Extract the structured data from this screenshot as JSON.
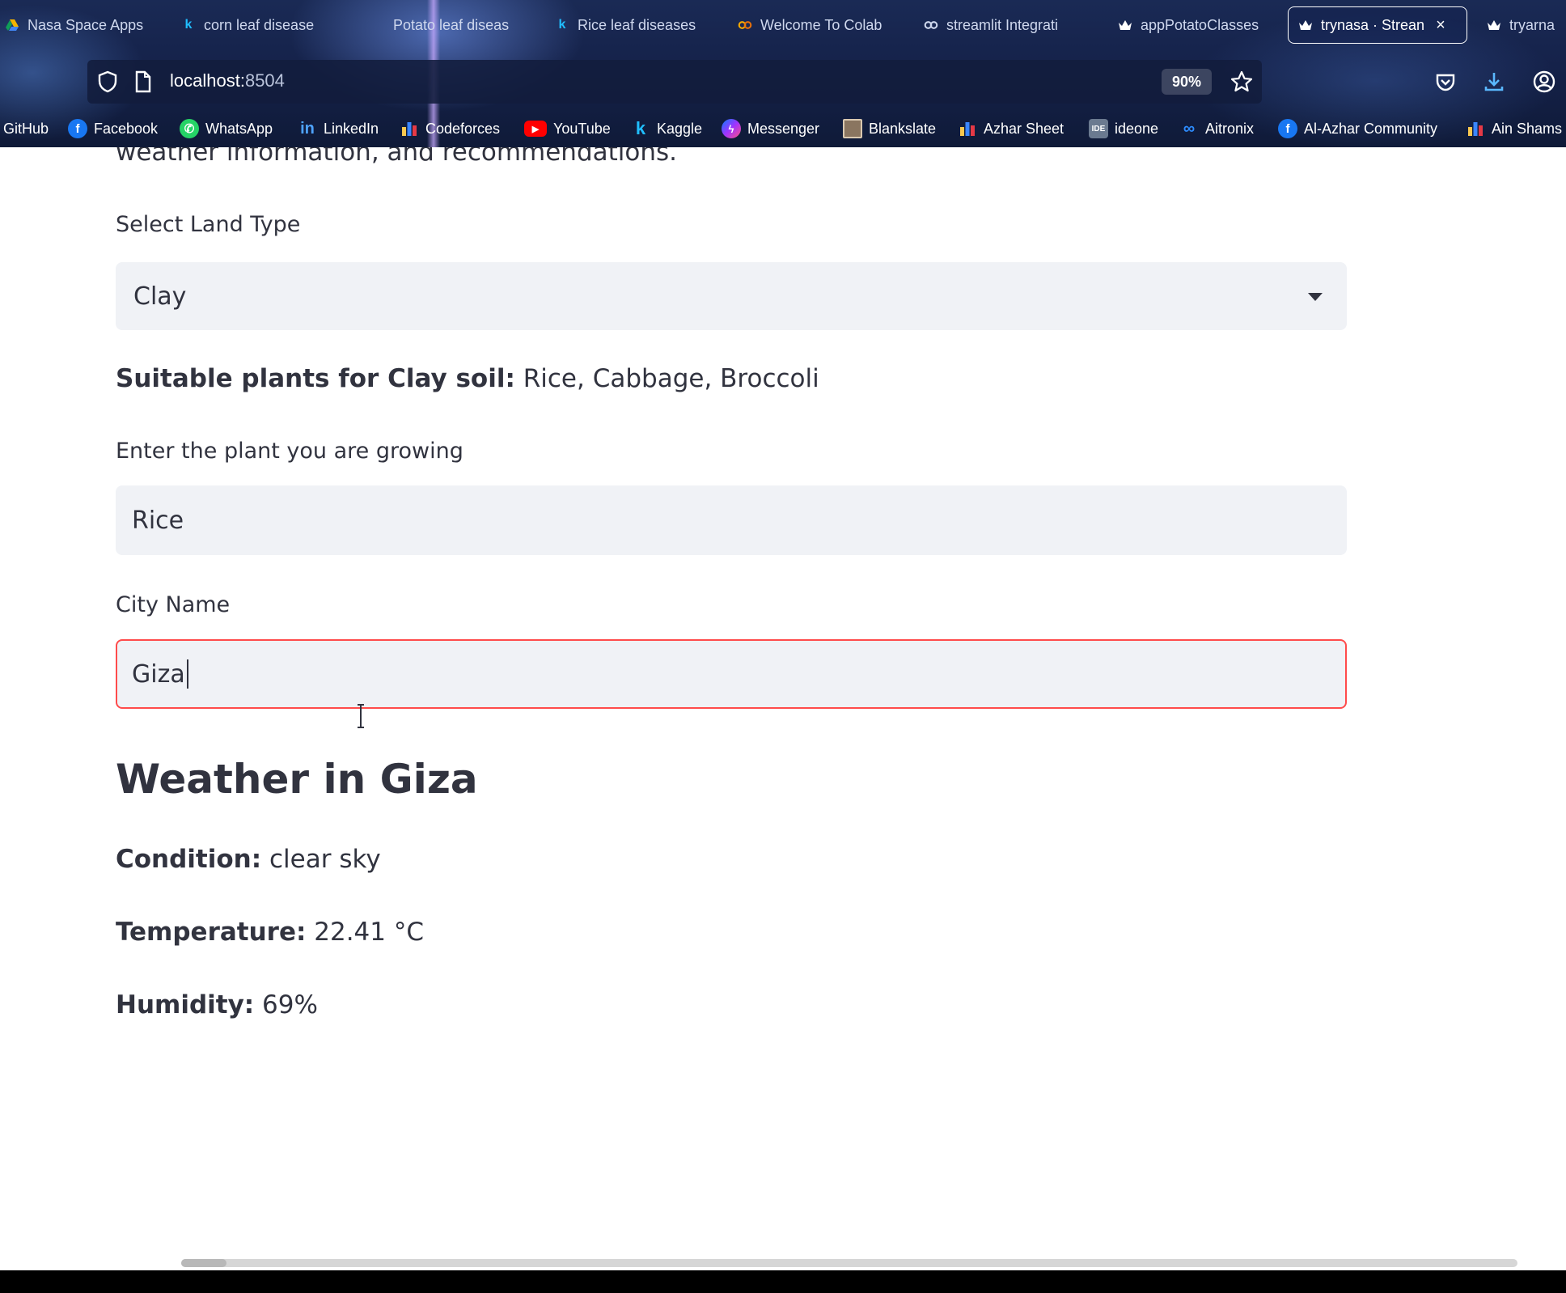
{
  "browser": {
    "tabs": [
      {
        "label": "Nasa Space Apps",
        "icon": "drive-icon"
      },
      {
        "label": "corn leaf disease",
        "icon": "kaggle-icon"
      },
      {
        "label": "Potato leaf diseas",
        "icon": "none"
      },
      {
        "label": "Rice leaf diseases",
        "icon": "kaggle-icon"
      },
      {
        "label": "Welcome To Colab",
        "icon": "colab-icon"
      },
      {
        "label": "streamlit Integrati",
        "icon": "colab-icon"
      },
      {
        "label": "appPotatoClasses",
        "icon": "streamlit-icon"
      },
      {
        "label": "trynasa · Strean",
        "icon": "streamlit-icon",
        "active": true
      },
      {
        "label": "tryarna",
        "icon": "streamlit-icon"
      }
    ],
    "url": {
      "host": "localhost:",
      "port": "8504"
    },
    "zoom": "90%",
    "bookmarks": [
      {
        "label": "GitHub"
      },
      {
        "label": "Facebook",
        "icon": "facebook-icon"
      },
      {
        "label": "WhatsApp",
        "icon": "whatsapp-icon"
      },
      {
        "label": "LinkedIn",
        "icon": "linkedin-icon"
      },
      {
        "label": "Codeforces",
        "icon": "codeforces-icon"
      },
      {
        "label": "YouTube",
        "icon": "youtube-icon"
      },
      {
        "label": "Kaggle",
        "icon": "kaggle-icon"
      },
      {
        "label": "Messenger",
        "icon": "messenger-icon"
      },
      {
        "label": "Blankslate",
        "icon": "blankslate-icon"
      },
      {
        "label": "Azhar Sheet",
        "icon": "codeforces-icon"
      },
      {
        "label": "ideone",
        "icon": "ideone-icon"
      },
      {
        "label": "Aitronix",
        "icon": "meta-icon"
      },
      {
        "label": "Al-Azhar Community",
        "icon": "facebook-icon"
      },
      {
        "label": "Ain Shams",
        "icon": "codeforces-icon"
      }
    ]
  },
  "app": {
    "intro_text": "weather information, and recommendations.",
    "land_type": {
      "label": "Select Land Type",
      "value": "Clay"
    },
    "suitable": {
      "label": "Suitable plants for Clay soil:",
      "value": "Rice, Cabbage, Broccoli"
    },
    "plant_input": {
      "label": "Enter the plant you are growing",
      "value": "Rice"
    },
    "city_input": {
      "label": "City Name",
      "value": "Giza"
    },
    "weather": {
      "heading": "Weather in Giza",
      "condition": {
        "label": "Condition:",
        "value": "clear sky"
      },
      "temperature": {
        "label": "Temperature:",
        "value": "22.41 °C"
      },
      "humidity": {
        "label": "Humidity:",
        "value": "69%"
      }
    }
  },
  "colors": {
    "accent": "#ff4b4b",
    "input_bg": "#f0f2f6",
    "text": "#31333f"
  }
}
